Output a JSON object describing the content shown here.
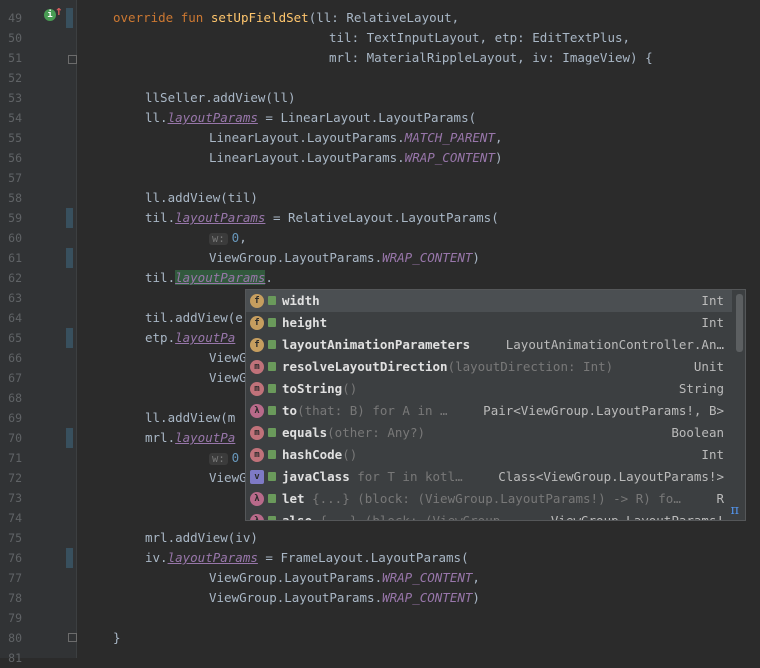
{
  "gutter": {
    "line_numbers": [
      "49",
      "50",
      "51",
      "52",
      "53",
      "54",
      "55",
      "56",
      "57",
      "58",
      "59",
      "60",
      "61",
      "62",
      "63",
      "64",
      "65",
      "66",
      "67",
      "68",
      "69",
      "70",
      "71",
      "72",
      "73",
      "74",
      "75",
      "76",
      "77",
      "78",
      "79",
      "80",
      "81"
    ]
  },
  "code": {
    "l49_kw": "override fun ",
    "l49_fn": "setUpFieldSet",
    "l49_rest": "(ll: RelativeLayout,",
    "l50": "til: TextInputLayout, etp: EditTextPlus,",
    "l51": "mrl: MaterialRippleLayout, iv: ImageView) {",
    "l53": "llSeller.addView(ll)",
    "l54_a": "ll.",
    "l54_prop": "layoutParams",
    "l54_b": " = LinearLayout.LayoutParams(",
    "l55_a": "LinearLayout.LayoutParams.",
    "l55_const": "MATCH_PARENT",
    "l55_b": ",",
    "l56_a": "LinearLayout.LayoutParams.",
    "l56_const": "WRAP_CONTENT",
    "l56_b": ")",
    "l58": "ll.addView(til)",
    "l59_a": "til.",
    "l59_prop": "layoutParams",
    "l59_b": " = RelativeLayout.LayoutParams(",
    "l60_hint": "w:",
    "l60_num": "0",
    "l60_b": ",",
    "l61_a": "ViewGroup.LayoutParams.",
    "l61_const": "WRAP_CONTENT",
    "l61_b": ")",
    "l62_a": "til.",
    "l62_prop": "layoutParams",
    "l62_b": ".",
    "l64": "til.addView(e",
    "l65_a": "etp.",
    "l65_prop": "layoutPa",
    "l66": "ViewG",
    "l67": "ViewG",
    "l69": "ll.addView(m",
    "l70_a": "mrl.",
    "l70_prop": "layoutPa",
    "l71_hint": "w:",
    "l71_num": "0",
    "l72": "ViewG",
    "l75": "mrl.addView(iv)",
    "l76_a": "iv.",
    "l76_prop": "layoutParams",
    "l76_b": " = FrameLayout.LayoutParams(",
    "l77_a": "ViewGroup.LayoutParams.",
    "l77_const": "WRAP_CONTENT",
    "l77_b": ",",
    "l78_a": "ViewGroup.LayoutParams.",
    "l78_const": "WRAP_CONTENT",
    "l78_b": ")",
    "l80": "}"
  },
  "completion": {
    "items": [
      {
        "kind": "f",
        "name": "width",
        "tail": "",
        "type": "Int"
      },
      {
        "kind": "f",
        "name": "height",
        "tail": "",
        "type": "Int"
      },
      {
        "kind": "f",
        "name": "layoutAnimationParameters",
        "tail": "",
        "type": "LayoutAnimationController.An…"
      },
      {
        "kind": "m",
        "name": "resolveLayoutDirection",
        "tail": "(layoutDirection: Int)",
        "type": "Unit"
      },
      {
        "kind": "m",
        "name": "toString",
        "tail": "()",
        "type": "String"
      },
      {
        "kind": "λ",
        "name": "to",
        "tail": "(that: B) for A in …",
        "type": "Pair<ViewGroup.LayoutParams!, B>"
      },
      {
        "kind": "m",
        "name": "equals",
        "tail": "(other: Any?)",
        "type": "Boolean"
      },
      {
        "kind": "m",
        "name": "hashCode",
        "tail": "()",
        "type": "Int"
      },
      {
        "kind": "v",
        "name": "javaClass",
        "tail": "for T in kotl…",
        "type": "Class<ViewGroup.LayoutParams!>"
      },
      {
        "kind": "λ",
        "name": "let",
        "tail": "{...} (block: (ViewGroup.LayoutParams!) -> R) fo…",
        "type": "R"
      },
      {
        "kind": "λ",
        "name": "also",
        "tail": "{...} (block: (ViewGroup…",
        "type": "ViewGroup.LayoutParams!"
      }
    ],
    "pi_symbol": "π"
  },
  "colors": {
    "background": "#2b2b2b",
    "keyword": "#cc7832",
    "function": "#ffc66d",
    "property": "#9876aa",
    "number": "#6897bb",
    "popup": "#3c3f41",
    "selected": "#4b4f52"
  }
}
